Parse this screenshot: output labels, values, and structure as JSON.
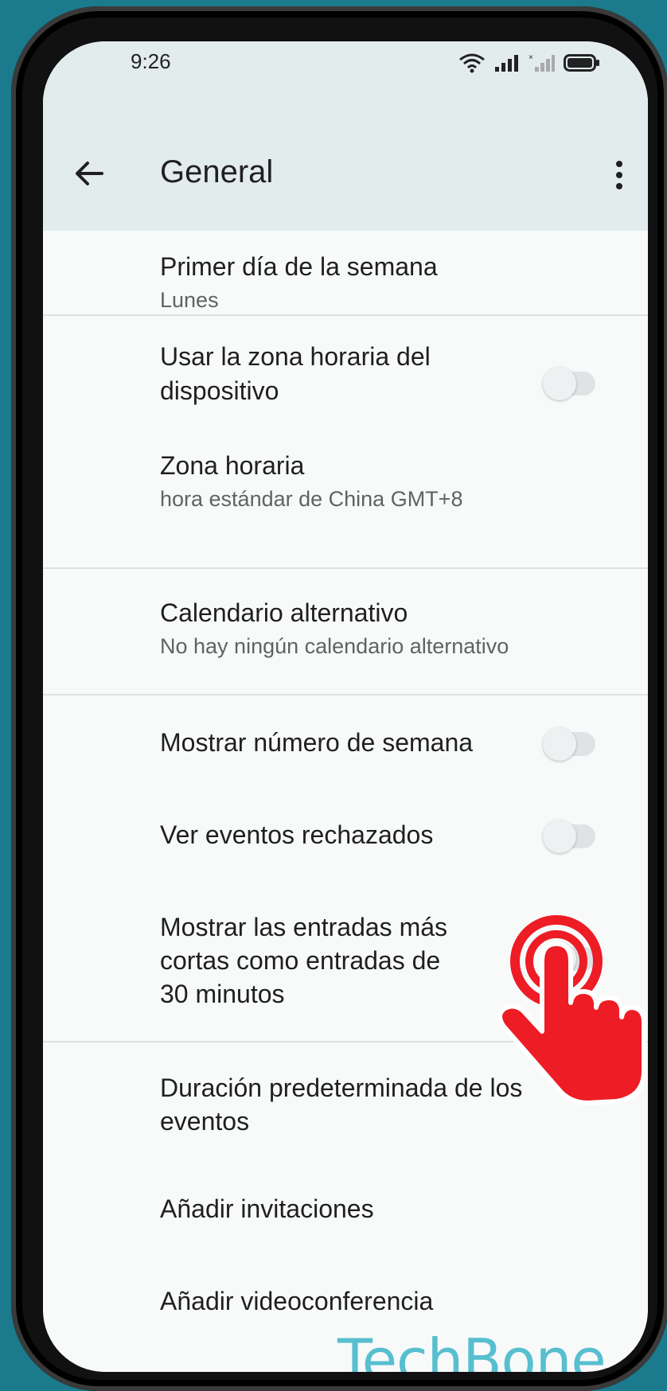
{
  "status": {
    "time": "9:26"
  },
  "header": {
    "title": "General"
  },
  "settings": {
    "first_day": {
      "title": "Primer día de la semana",
      "value": "Lunes"
    },
    "device_tz": {
      "title_line1": "Usar la zona horaria del",
      "title_line2": "dispositivo",
      "enabled": false
    },
    "timezone": {
      "title": "Zona horaria",
      "value": "hora estándar de China  GMT+8"
    },
    "alt_calendar": {
      "title": "Calendario alternativo",
      "value": "No hay ningún calendario alternativo"
    },
    "week_number": {
      "title": "Mostrar número de semana",
      "enabled": false
    },
    "declined_events": {
      "title": "Ver eventos rechazados",
      "enabled": false
    },
    "short_entries": {
      "title_line1": "Mostrar las entradas más",
      "title_line2": "cortas como entradas de",
      "title_line3": "30 minutos",
      "enabled": false
    },
    "default_duration": {
      "title_line1": "Duración predeterminada de los",
      "title_line2": "eventos"
    },
    "add_invites": {
      "title": "Añadir invitaciones"
    },
    "add_video": {
      "title": "Añadir videoconferencia"
    }
  },
  "watermark": "TechBone",
  "colors": {
    "background": "#1b7a8c",
    "header": "#e3eced",
    "hand": "#ee1c24",
    "watermark": "#57bfcf"
  }
}
